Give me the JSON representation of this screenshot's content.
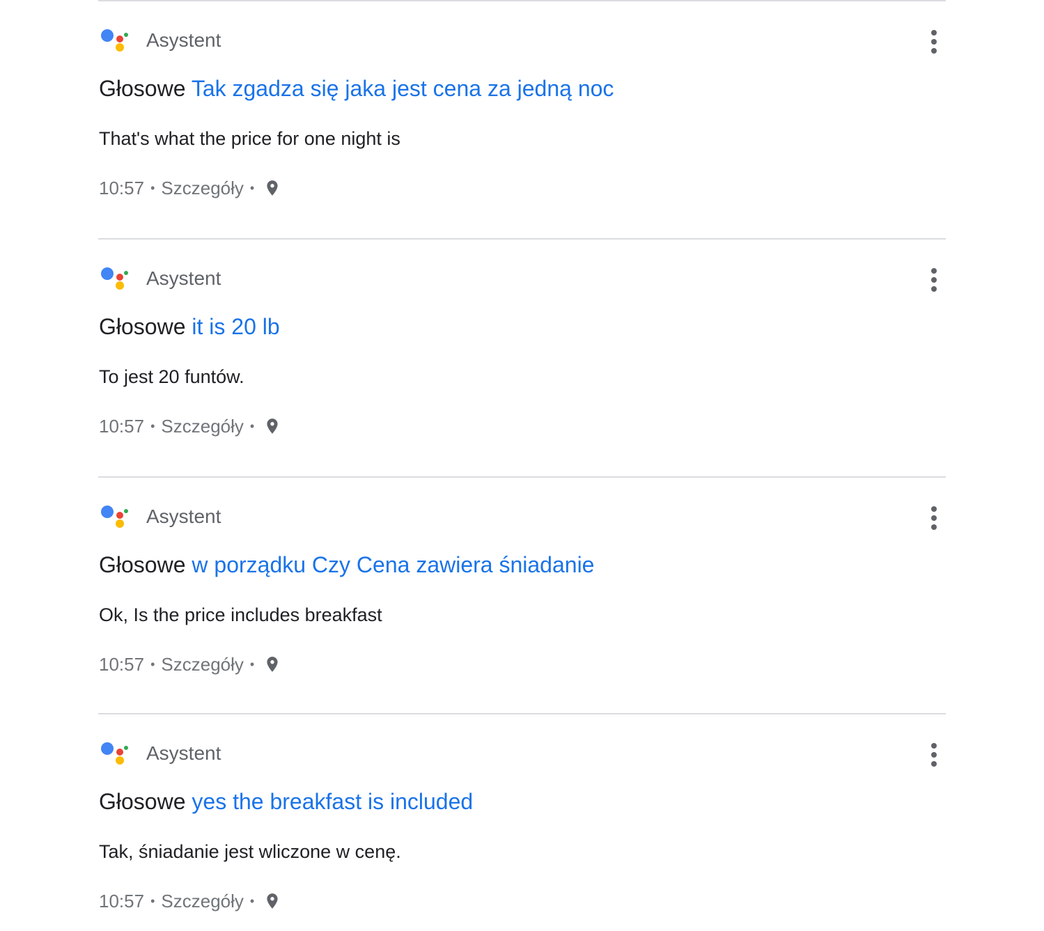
{
  "colors": {
    "query_blue": "#1a73e8",
    "text_dark": "#202124",
    "text_grey": "#5f6368",
    "divider": "#dadce0",
    "logo_blue": "#4285f4",
    "logo_red": "#ea4335",
    "logo_yellow": "#fbbc05",
    "logo_green": "#34a853"
  },
  "entries": [
    {
      "app_name": "Asystent",
      "prefix": "Głosowe",
      "query": "Tak zgadza się jaka jest cena za jedną noc",
      "response": "That's what the price for one night is",
      "time": "10:57",
      "details_label": "Szczegóły",
      "separator": "•",
      "location_icon": "location-pin-icon",
      "menu_icon": "more-vert-icon"
    },
    {
      "app_name": "Asystent",
      "prefix": "Głosowe",
      "query": "it is 20 lb",
      "response": "To jest 20 funtów.",
      "time": "10:57",
      "details_label": "Szczegóły",
      "separator": "•",
      "location_icon": "location-pin-icon",
      "menu_icon": "more-vert-icon"
    },
    {
      "app_name": "Asystent",
      "prefix": "Głosowe",
      "query": "w porządku Czy Cena zawiera śniadanie",
      "response": "Ok, Is the price includes breakfast",
      "time": "10:57",
      "details_label": "Szczegóły",
      "separator": "•",
      "location_icon": "location-pin-icon",
      "menu_icon": "more-vert-icon"
    },
    {
      "app_name": "Asystent",
      "prefix": "Głosowe",
      "query": "yes the breakfast is included",
      "response": "Tak, śniadanie jest wliczone w cenę.",
      "time": "10:57",
      "details_label": "Szczegóły",
      "separator": "•",
      "location_icon": "location-pin-icon",
      "menu_icon": "more-vert-icon"
    }
  ]
}
